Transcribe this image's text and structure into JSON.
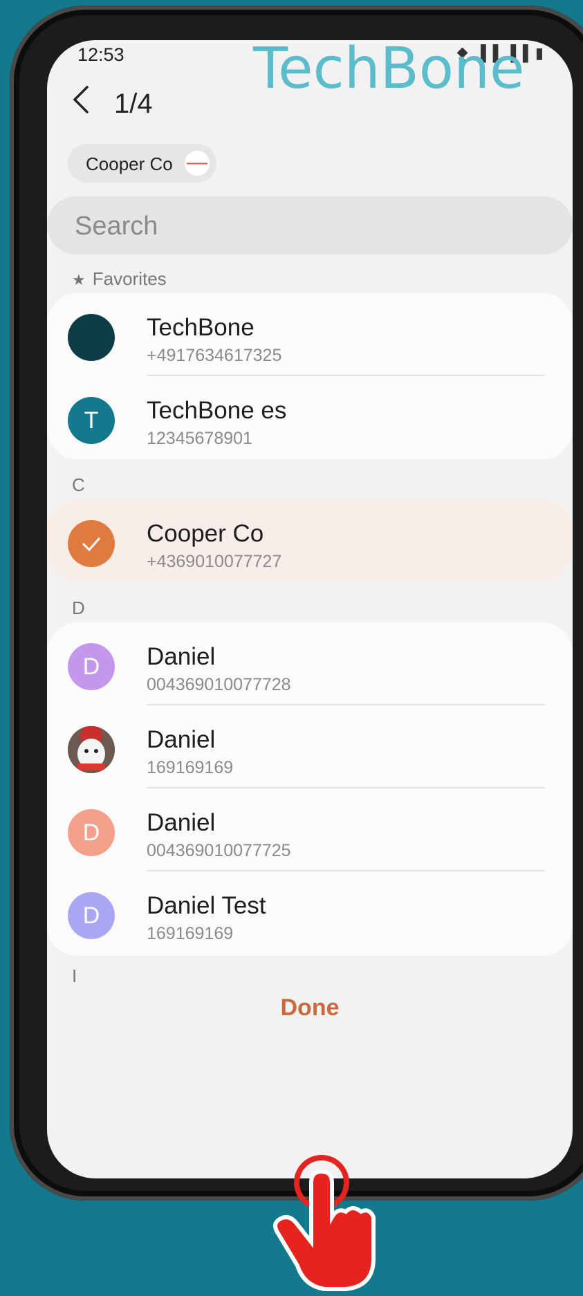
{
  "status": {
    "time": "12:53",
    "icons": "⧪.▐▐ ▐▐ ▮"
  },
  "watermark": "TechBone",
  "header": {
    "counter": "1/4"
  },
  "chip": {
    "label": "Cooper Co"
  },
  "search": {
    "placeholder": "Search"
  },
  "sections": {
    "favorites": "Favorites",
    "c": "C",
    "d": "D",
    "i": "I"
  },
  "favorites": [
    {
      "name": "TechBone",
      "phone": "+4917634617325",
      "avatar_color": "#0f3d47",
      "initial": ""
    },
    {
      "name": "TechBone es",
      "phone": "12345678901",
      "avatar_color": "#127a8c",
      "initial": "T"
    }
  ],
  "c_contacts": [
    {
      "name": "Cooper Co",
      "phone": "+4369010077727",
      "avatar_color": "#e07a3e",
      "selected": true
    }
  ],
  "d_contacts": [
    {
      "name": "Daniel",
      "phone": "004369010077728",
      "avatar_color": "#c497ec",
      "initial": "D"
    },
    {
      "name": "Daniel",
      "phone": "169169169",
      "avatar_color": "#4a4a4a",
      "initial": ""
    },
    {
      "name": "Daniel",
      "phone": "004369010077725",
      "avatar_color": "#f3a08c",
      "initial": "D"
    },
    {
      "name": "Daniel Test",
      "phone": "169169169",
      "avatar_color": "#a9a6f3",
      "initial": "D"
    }
  ],
  "footer": {
    "done": "Done"
  }
}
